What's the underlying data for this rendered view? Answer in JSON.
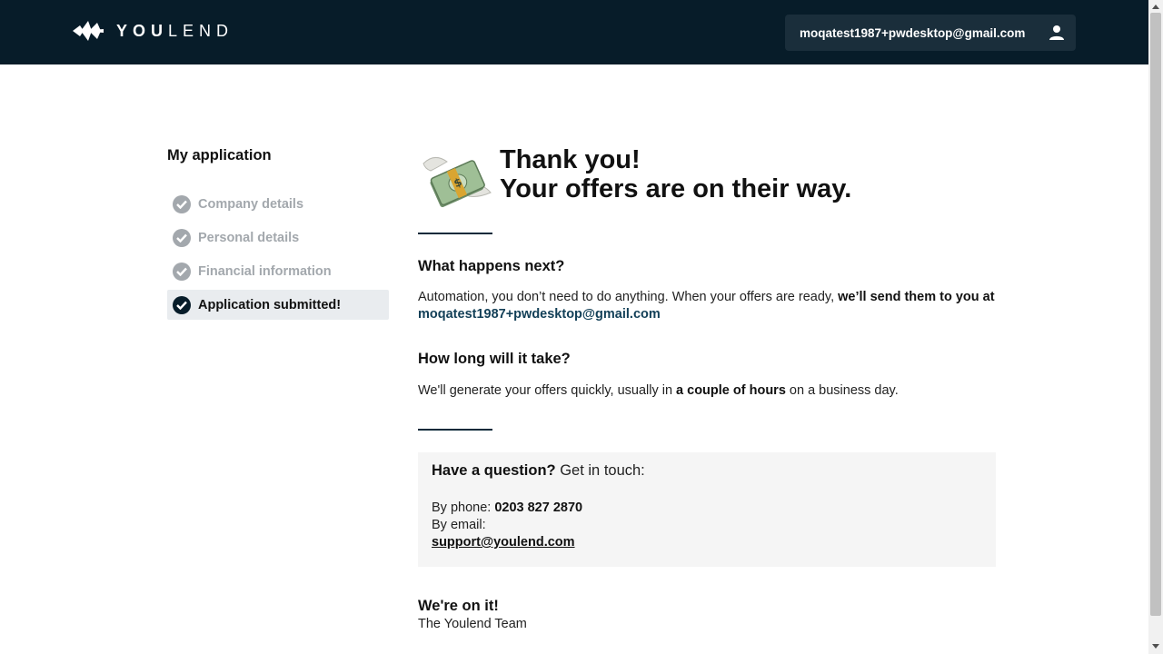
{
  "header": {
    "logo_text_bold": "YOU",
    "logo_text_light": "LEND",
    "user_email": "moqatest1987+pwdesktop@gmail.com",
    "user_icon": "person-icon",
    "background": "#071c29"
  },
  "sidebar": {
    "title": "My application",
    "steps": [
      {
        "label": "Company details",
        "status": "done"
      },
      {
        "label": "Personal details",
        "status": "done"
      },
      {
        "label": "Financial information",
        "status": "done"
      },
      {
        "label": "Application submitted!",
        "status": "active"
      }
    ]
  },
  "main": {
    "hero_icon": "money-with-wings-icon",
    "title_line1": "Thank you!",
    "title_line2": "Your offers are on their way.",
    "next": {
      "heading": "What happens next?",
      "text_plain": "Automation, you don’t need to do anything. When your offers are ready, ",
      "text_bold": "we’ll send them to you at ",
      "email": "moqatest1987+pwdesktop@gmail.com"
    },
    "duration": {
      "heading": "How long will it take?",
      "text_before": "We'll generate your offers quickly, usually in ",
      "text_bold": "a couple of hours",
      "text_after": " on a business day."
    },
    "contact": {
      "heading_bold": "Have a question?",
      "heading_rest": " Get in touch:",
      "phone_label": "By phone: ",
      "phone": "0203 827 2870",
      "email_label": "By email:",
      "email": "support@youlend.com"
    },
    "signoff": {
      "heading": "We're on it!",
      "team": "The Youlend Team"
    }
  }
}
